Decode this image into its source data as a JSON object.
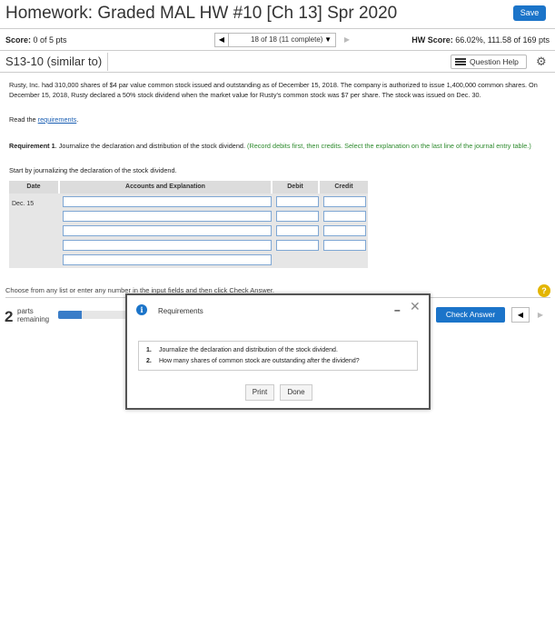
{
  "header": {
    "title": "Homework: Graded MAL HW #10 [Ch 13] Spr 2020",
    "save_label": "Save"
  },
  "score_bar": {
    "score_label": "Score:",
    "score_value": "0 of 5 pts",
    "nav_position": "18 of 18 (11 complete)",
    "hw_score_label": "HW Score:",
    "hw_score_value": "66.02%, 111.58 of 169 pts"
  },
  "question": {
    "title": "S13-10 (similar to)",
    "help_label": "Question Help"
  },
  "problem": {
    "text": "Rusty, Inc. had 310,000 shares of $4 par value common stock issued and outstanding as of December 15, 2018. The company is authorized to issue 1,400,000 common shares. On December 15, 2018, Rusty declared a 50% stock dividend when the market value for Rusty's common stock was $7 per share. The stock was issued on Dec. 30.",
    "read_prefix": "Read the",
    "read_link": "requirements",
    "read_suffix": "."
  },
  "requirement1": {
    "label": "Requirement 1",
    "text": ". Journalize the declaration and distribution of the stock dividend.",
    "green_text": "(Record debits first, then credits. Select the explanation on the last line of the journal entry table.)",
    "start_text": "Start by journalizing the declaration of the stock dividend."
  },
  "journal": {
    "headers": [
      "Date",
      "Accounts and Explanation",
      "Debit",
      "Credit"
    ],
    "date_value": "Dec. 15"
  },
  "footer": {
    "hint": "Choose from any list or enter any number in the input fields and then click Check Answer.",
    "help_badge": "?",
    "parts_number": "2",
    "parts_label_1": "parts",
    "parts_label_2": "remaining",
    "progress_fraction": 0.33,
    "check_answer_label": "Check Answer"
  },
  "modal": {
    "info_glyph": "i",
    "title": "Requirements",
    "items": [
      {
        "num": "1.",
        "text": "Journalize the declaration and distribution of the stock dividend."
      },
      {
        "num": "2.",
        "text": "How many shares of common stock are outstanding after the dividend?"
      }
    ],
    "print_label": "Print",
    "done_label": "Done"
  },
  "colors": {
    "accent": "#1b74c9",
    "green_text": "#2d8a2d",
    "help_badge": "#e3b500"
  }
}
